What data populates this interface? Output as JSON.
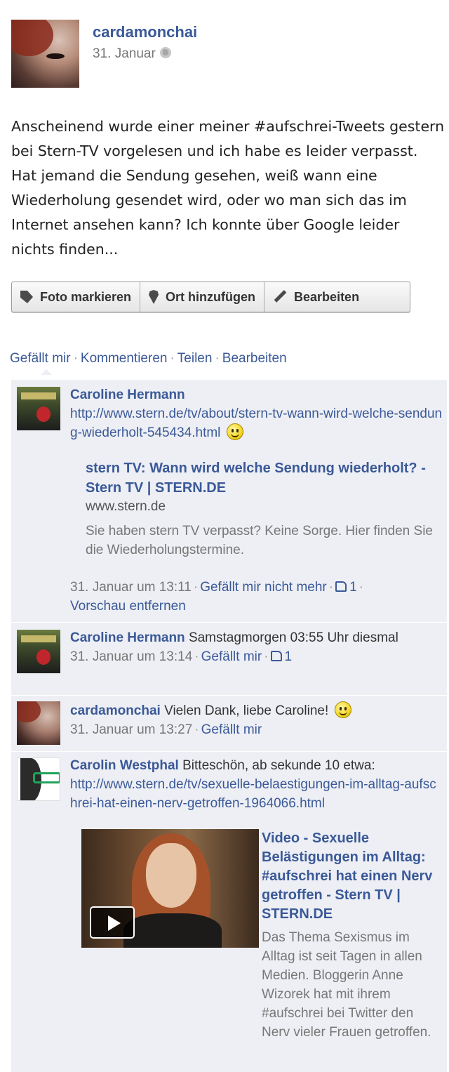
{
  "post": {
    "author": "cardamonchai",
    "date": "31. Januar",
    "text": "Anscheinend wurde einer meiner #aufschrei-Tweets gestern bei Stern-TV vorgelesen und ich habe es leider verpasst. Hat jemand die Sendung gesehen, weiß wann eine Wiederholung gesendet wird, oder wo man sich das im Internet ansehen kann? Ich konnte über Google leider nichts finden..."
  },
  "actionbar": {
    "tag_photo": "Foto markieren",
    "add_place": "Ort hinzufügen",
    "edit": "Bearbeiten"
  },
  "post_actions": {
    "like": "Gefällt mir",
    "comment": "Kommentieren",
    "share": "Teilen",
    "edit": "Bearbeiten"
  },
  "comments": [
    {
      "author": "Caroline Hermann",
      "link": "http://www.stern.de/tv/about/stern-tv-wann-wird-welche-sendung-wiederholt-545434.html",
      "share_title": "stern TV: Wann wird welche Sendung wiederholt? - Stern TV | STERN.DE",
      "share_domain": "www.stern.de",
      "share_desc": "Sie haben stern TV verpasst? Keine Sorge. Hier finden Sie die Wiederholungstermine.",
      "time": "31. Januar um 13:11",
      "unlike": "Gefällt mir nicht mehr",
      "likes": "1",
      "remove_preview": "Vorschau entfernen"
    },
    {
      "author": "Caroline Hermann",
      "text": "Samstagmorgen 03:55 Uhr diesmal",
      "time": "31. Januar um 13:14",
      "like": "Gefällt mir",
      "likes": "1"
    },
    {
      "author": "cardamonchai",
      "text": "Vielen Dank, liebe Caroline!",
      "time": "31. Januar um 13:27",
      "like": "Gefällt mir"
    },
    {
      "author": "Carolin Westphal",
      "text": "Bitteschön, ab sekunde 10 etwa:",
      "link": "http://www.stern.de/tv/sexuelle-belaestigungen-im-alltag-aufschrei-hat-einen-nerv-getroffen-1964066.html",
      "video_title": "Video - Sexuelle Belästigungen im Alltag: #aufschrei hat einen Nerv getroffen - Stern TV | STERN.DE",
      "video_desc": "Das Thema Sexismus im Alltag ist seit Tagen in allen Medien. Bloggerin Anne Wizorek hat mit ihrem #aufschrei bei Twitter den Nerv vieler Frauen getroffen."
    }
  ]
}
